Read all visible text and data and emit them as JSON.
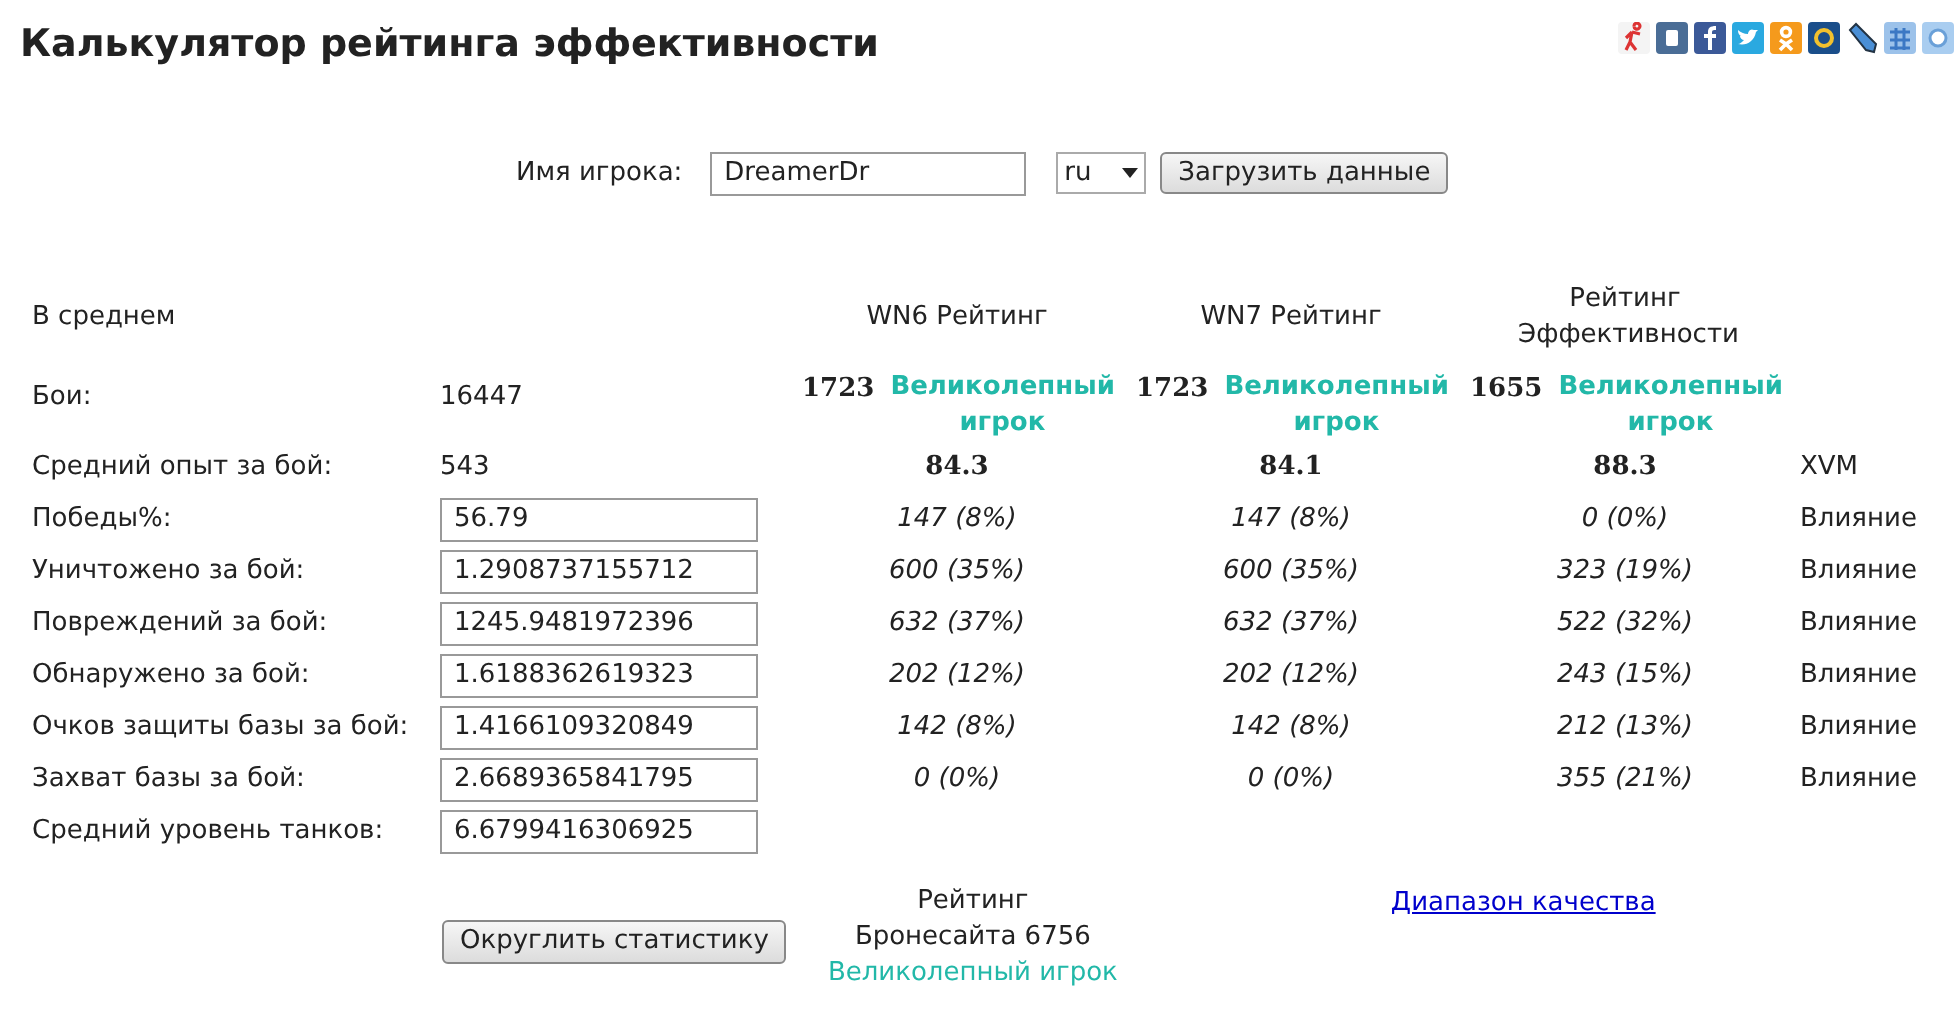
{
  "title": "Калькулятор рейтинга эффективности",
  "share_icons": [
    {
      "kind": "figure"
    },
    {
      "kind": "vk"
    },
    {
      "kind": "fb"
    },
    {
      "kind": "bird"
    },
    {
      "kind": "ok"
    },
    {
      "kind": "mail"
    },
    {
      "kind": "pencil"
    },
    {
      "kind": "grid"
    },
    {
      "kind": "flower"
    }
  ],
  "player": {
    "label": "Имя игрока:",
    "value": "DreamerDr",
    "language": "ru",
    "button": "Загрузить данные"
  },
  "table": {
    "label": "В среднем",
    "columns": [
      "WN6 Рейтинг",
      "WN7 Рейтинг",
      "Рейтинг Эффективности"
    ],
    "rows": [
      {
        "kind": "ratings",
        "label": "Бои:",
        "value": "16447",
        "cells": [
          {
            "score": "1723",
            "grade": "Великолепный игрок",
            "color": "#22b8a8"
          },
          {
            "score": "1723",
            "grade": "Великолепный игрок",
            "color": "#22b8a8"
          },
          {
            "score": "1655",
            "grade": "Великолепный игрок",
            "color": "#22b8a8"
          }
        ]
      },
      {
        "kind": "totals",
        "label": "Средний опыт за бой:",
        "value": "543",
        "cells": [
          "84.3",
          "84.1",
          "88.3"
        ],
        "note": "XVM"
      },
      {
        "kind": "input",
        "label": "Победы%:",
        "value": "56.79",
        "cells": [
          "147 (8%)",
          "147 (8%)",
          "0 (0%)"
        ],
        "note": "Влияние"
      },
      {
        "kind": "input",
        "label": "Уничтожено за бой:",
        "value": "1.2908737155712",
        "cells": [
          "600 (35%)",
          "600 (35%)",
          "323 (19%)"
        ],
        "note": "Влияние"
      },
      {
        "kind": "input",
        "label": "Повреждений за бой:",
        "value": "1245.9481972396",
        "cells": [
          "632 (37%)",
          "632 (37%)",
          "522 (32%)"
        ],
        "note": "Влияние"
      },
      {
        "kind": "input",
        "label": "Обнаружено за бой:",
        "value": "1.6188362619323",
        "cells": [
          "202 (12%)",
          "202 (12%)",
          "243 (15%)"
        ],
        "note": "Влияние"
      },
      {
        "kind": "input",
        "label": "Очков защиты базы за бой:",
        "value": "1.4166109320849",
        "cells": [
          "142 (8%)",
          "142 (8%)",
          "212 (13%)"
        ],
        "note": "Влияние"
      },
      {
        "kind": "input",
        "label": "Захват базы за бой:",
        "value": "2.6689365841795",
        "cells": [
          "0 (0%)",
          "0 (0%)",
          "355 (21%)"
        ],
        "note": "Влияние"
      },
      {
        "kind": "input",
        "label": "Средний уровень танков:",
        "value": "6.6799416306925"
      }
    ]
  },
  "footer": {
    "button": "Округлить статистику",
    "rating": "Рейтинг Бронесайта 6756",
    "grade": "Великолепный игрок",
    "link": "Диапазон качества"
  }
}
